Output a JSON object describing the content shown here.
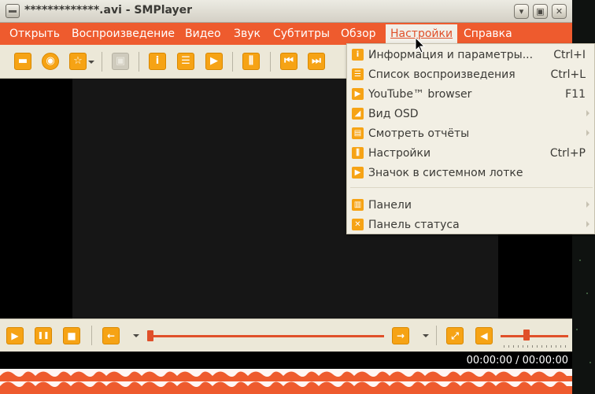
{
  "window": {
    "title": "*************.avi - SMPlayer",
    "buttons": {
      "minimize": "▾",
      "maximize": "▣",
      "close": "✕"
    }
  },
  "menubar": {
    "items": [
      {
        "label": "Открыть"
      },
      {
        "label": "Воспроизведение"
      },
      {
        "label": "Видео"
      },
      {
        "label": "Звук"
      },
      {
        "label": "Субтитры"
      },
      {
        "label": "Обзор"
      },
      {
        "label": "Настройки"
      },
      {
        "label": "Справка"
      }
    ],
    "active": "Настройки"
  },
  "toolbar": {
    "buttons": [
      {
        "name": "open-file-icon",
        "glyph": "▬"
      },
      {
        "name": "globe-icon",
        "glyph": "◉"
      },
      {
        "name": "favorites-star-icon",
        "glyph": "☆"
      },
      {
        "name": "screenshot-icon",
        "glyph": "▣"
      },
      {
        "name": "info-icon",
        "glyph": "i"
      },
      {
        "name": "playlist-icon",
        "glyph": "☰"
      },
      {
        "name": "youtube-icon",
        "glyph": "▶"
      },
      {
        "name": "equalizer-icon",
        "glyph": "⫼"
      },
      {
        "name": "previous-icon",
        "glyph": "⏮"
      },
      {
        "name": "next-icon",
        "glyph": "⏭"
      }
    ]
  },
  "controls": {
    "play": "▶",
    "pause": "❚❚",
    "stop": "■",
    "rewind": "←",
    "forward": "→",
    "fullscreen": "⤢",
    "mute": "◀",
    "seek_position": 0.0,
    "volume_level": 0.35
  },
  "time": {
    "display": "00:00:00 / 00:00:00"
  },
  "settings_menu": {
    "items": [
      {
        "label": "Информация и параметры...",
        "shortcut": "Ctrl+I",
        "icon": "info-icon",
        "glyph": "i",
        "submenu": false
      },
      {
        "label": "Список воспроизведения",
        "shortcut": "Ctrl+L",
        "icon": "playlist-icon",
        "glyph": "☰",
        "submenu": false
      },
      {
        "label": "YouTube™ browser",
        "shortcut": "F11",
        "icon": "youtube-icon",
        "glyph": "▶",
        "submenu": false
      },
      {
        "label": "Вид OSD",
        "shortcut": "",
        "icon": "osd-icon",
        "glyph": "◢",
        "submenu": true
      },
      {
        "label": "Смотреть отчёты",
        "shortcut": "",
        "icon": "logs-icon",
        "glyph": "▤",
        "submenu": true
      },
      {
        "label": "Настройки",
        "shortcut": "Ctrl+P",
        "icon": "preferences-icon",
        "glyph": "⫼",
        "submenu": false
      },
      {
        "label": "Значок в системном лотке",
        "shortcut": "",
        "icon": "tray-icon",
        "glyph": "▶",
        "submenu": false
      },
      {
        "label": "Панели",
        "shortcut": "",
        "icon": "toolbars-icon",
        "glyph": "▥",
        "submenu": true
      },
      {
        "label": "Панель статуса",
        "shortcut": "",
        "icon": "statusbar-icon",
        "glyph": "✕",
        "submenu": true
      }
    ]
  },
  "colors": {
    "accent": "#ee5b2e",
    "icon_orange": "#f6a315",
    "panel": "#ece8d8"
  }
}
